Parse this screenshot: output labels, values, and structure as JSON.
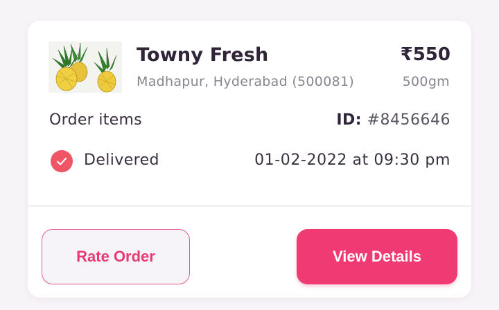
{
  "order_card": {
    "shop_name": "Towny Fresh",
    "shop_address": "Madhapur, Hyderabad (500081)",
    "price": "₹550",
    "weight": "500gm",
    "order_items_label": "Order items",
    "order_id_label": "ID:",
    "order_id_value": "#8456646",
    "status": "Delivered",
    "delivered_at": "01-02-2022 at 09:30 pm",
    "product_image_icon": "pineapple-icon"
  },
  "actions": {
    "rate_label": "Rate Order",
    "view_label": "View Details"
  },
  "colors": {
    "accent": "#f03a74",
    "status_delivered": "#f05566",
    "title_text": "#2f2438",
    "muted_text": "#8a8490"
  }
}
